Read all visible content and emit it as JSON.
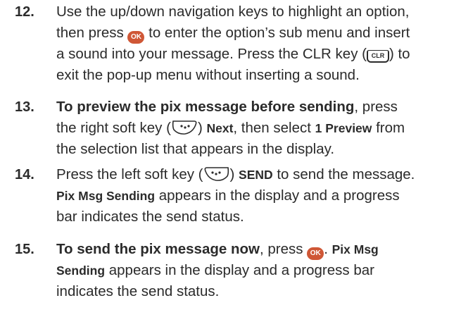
{
  "steps": [
    {
      "number": "12.",
      "lines": {
        "l1": "Use the up/down navigation keys to highlight an option,",
        "l2a": "then press",
        "l2b": "to enter the option’s sub menu and insert",
        "l3a": "a sound into your message. Press the CLR key (",
        "l3b": ") to",
        "l4": "exit the pop-up menu without inserting a sound."
      }
    },
    {
      "number": "13.",
      "lines": {
        "l1a": "To preview the pix message before sending",
        "l1b": ", press",
        "l2a": "the right soft key (",
        "l2b": ")",
        "l2c": "Next",
        "l2d": ", then select",
        "l2e": "1 Preview",
        "l2f": "from",
        "l3": "the selection list that appears in the display."
      }
    },
    {
      "number": "14.",
      "lines": {
        "l1a": "Press the left soft key (",
        "l1b": ")",
        "l1c": "SEND",
        "l1d": "to send the message.",
        "l2a": "Pix Msg Sending",
        "l2b": "appears in the display and a progress",
        "l3": "bar indicates the send status."
      }
    },
    {
      "number": "15.",
      "lines": {
        "l1a": "To send the pix message now",
        "l1b": ", press",
        "l1c": ".",
        "l1d": "Pix Msg",
        "l2a": "Sending",
        "l2b": "appears in the display and a progress bar",
        "l3": "indicates the send status."
      }
    }
  ],
  "icons": {
    "ok_label": "OK",
    "clr_label": "CLR"
  }
}
